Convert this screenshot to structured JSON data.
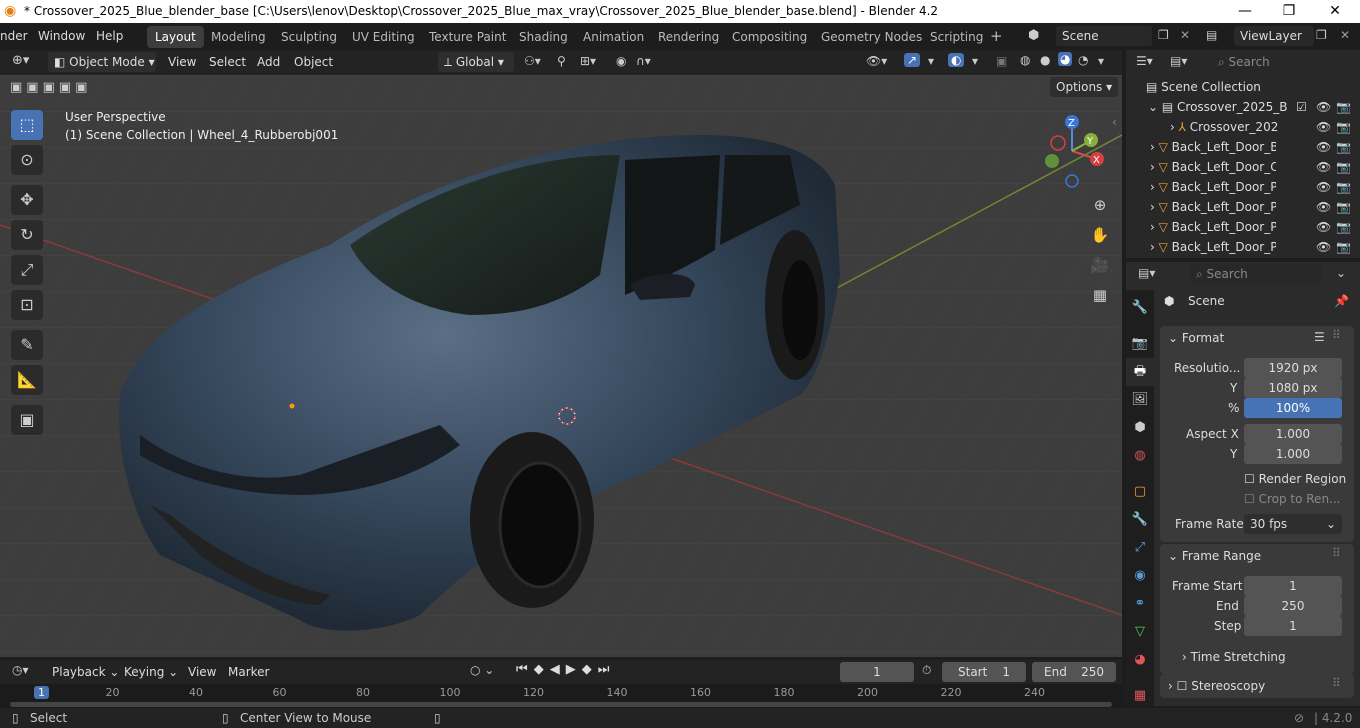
{
  "window": {
    "title": "* Crossover_2025_Blue_blender_base [C:\\Users\\lenov\\Desktop\\Crossover_2025_Blue_max_vray\\Crossover_2025_Blue_blender_base.blend] - Blender 4.2"
  },
  "menu": {
    "items": [
      "nder",
      "Window",
      "Help"
    ]
  },
  "workspaces": [
    "Layout",
    "Modeling",
    "Sculpting",
    "UV Editing",
    "Texture Paint",
    "Shading",
    "Animation",
    "Rendering",
    "Compositing",
    "Geometry Nodes",
    "Scripting"
  ],
  "scene": {
    "name": "Scene",
    "view_layer": "ViewLayer"
  },
  "viewport": {
    "mode": "Object Mode",
    "menus": [
      "View",
      "Select",
      "Add",
      "Object"
    ],
    "transform": "Global",
    "options": "Options",
    "overlay_title": "User Perspective",
    "overlay_subtitle": "(1) Scene Collection | Wheel_4_Rubberobj001",
    "gizmo": {
      "x": "X",
      "y": "Y",
      "z": "Z"
    }
  },
  "outliner": {
    "search_placeholder": "Search",
    "root": "Scene Collection",
    "collection": "Crossover_2025_B",
    "items": [
      "Crossover_202",
      "Back_Left_Door_Bo",
      "Back_Left_Door_Clc",
      "Back_Left_Door_Pla",
      "Back_Left_Door_Pla",
      "Back_Left_Door_Pla",
      "Back_Left_Door_Pla"
    ]
  },
  "properties": {
    "search_placeholder": "Search",
    "context": "Scene",
    "format": {
      "title": "Format",
      "resolution_label": "Resolutio...",
      "res_x": "1920 px",
      "y_label": "Y",
      "res_y": "1080 px",
      "pct_label": "%",
      "pct": "100%",
      "aspect_label": "Aspect X",
      "aspect_x": "1.000",
      "aspect_y_label": "Y",
      "aspect_y": "1.000",
      "render_region": "Render Region",
      "crop": "Crop to Ren...",
      "frame_rate_label": "Frame Rate",
      "frame_rate": "30 fps"
    },
    "frame_range": {
      "title": "Frame Range",
      "start_label": "Frame Start",
      "start": "1",
      "end_label": "End",
      "end": "250",
      "step_label": "Step",
      "step": "1",
      "time_stretching": "Time Stretching"
    },
    "stereoscopy": "Stereoscopy"
  },
  "timeline": {
    "menus": [
      "Playback",
      "Keying",
      "View",
      "Marker"
    ],
    "current_frame": "1",
    "start_label": "Start",
    "start": "1",
    "end_label": "End",
    "end": "250",
    "ruler": [
      "1",
      "20",
      "40",
      "60",
      "80",
      "100",
      "120",
      "140",
      "160",
      "180",
      "200",
      "220",
      "240"
    ]
  },
  "status": {
    "select": "Select",
    "center": "Center View to Mouse",
    "version": "4.2.0"
  },
  "colors": {
    "accent": "#4772b3",
    "viewport_bg": "#3d3d3d",
    "panel_bg": "#2b2b2b",
    "header_bg": "#232323"
  }
}
